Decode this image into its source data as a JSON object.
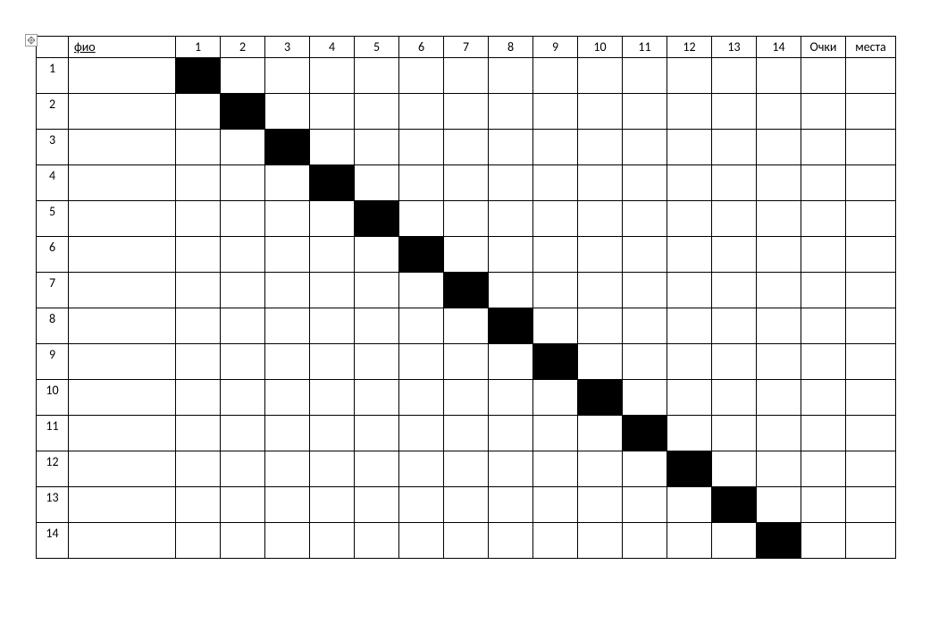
{
  "table": {
    "headers": {
      "rownum": "",
      "name": "фио",
      "cols": [
        "1",
        "2",
        "3",
        "4",
        "5",
        "6",
        "7",
        "8",
        "9",
        "10",
        "11",
        "12",
        "13",
        "14"
      ],
      "points": "Очки",
      "place": "места"
    },
    "rows": [
      {
        "num": "1",
        "name": "",
        "scores": [
          "",
          "",
          "",
          "",
          "",
          "",
          "",
          "",
          "",
          "",
          "",
          "",
          "",
          ""
        ],
        "black": 0,
        "points": "",
        "place": ""
      },
      {
        "num": "2",
        "name": "",
        "scores": [
          "",
          "",
          "",
          "",
          "",
          "",
          "",
          "",
          "",
          "",
          "",
          "",
          "",
          ""
        ],
        "black": 1,
        "points": "",
        "place": ""
      },
      {
        "num": "3",
        "name": "",
        "scores": [
          "",
          "",
          "",
          "",
          "",
          "",
          "",
          "",
          "",
          "",
          "",
          "",
          "",
          ""
        ],
        "black": 2,
        "points": "",
        "place": ""
      },
      {
        "num": "4",
        "name": "",
        "scores": [
          "",
          "",
          "",
          "",
          "",
          "",
          "",
          "",
          "",
          "",
          "",
          "",
          "",
          ""
        ],
        "black": 3,
        "points": "",
        "place": ""
      },
      {
        "num": "5",
        "name": "",
        "scores": [
          "",
          "",
          "",
          "",
          "",
          "",
          "",
          "",
          "",
          "",
          "",
          "",
          "",
          ""
        ],
        "black": 4,
        "points": "",
        "place": ""
      },
      {
        "num": "6",
        "name": "",
        "scores": [
          "",
          "",
          "",
          "",
          "",
          "",
          "",
          "",
          "",
          "",
          "",
          "",
          "",
          ""
        ],
        "black": 5,
        "points": "",
        "place": ""
      },
      {
        "num": "7",
        "name": "",
        "scores": [
          "",
          "",
          "",
          "",
          "",
          "",
          "",
          "",
          "",
          "",
          "",
          "",
          "",
          ""
        ],
        "black": 6,
        "points": "",
        "place": ""
      },
      {
        "num": "8",
        "name": "",
        "scores": [
          "",
          "",
          "",
          "",
          "",
          "",
          "",
          "",
          "",
          "",
          "",
          "",
          "",
          ""
        ],
        "black": 7,
        "points": "",
        "place": ""
      },
      {
        "num": "9",
        "name": "",
        "scores": [
          "",
          "",
          "",
          "",
          "",
          "",
          "",
          "",
          "",
          "",
          "",
          "",
          "",
          ""
        ],
        "black": 8,
        "points": "",
        "place": ""
      },
      {
        "num": "10",
        "name": "",
        "scores": [
          "",
          "",
          "",
          "",
          "",
          "",
          "",
          "",
          "",
          "",
          "",
          "",
          "",
          ""
        ],
        "black": 9,
        "points": "",
        "place": ""
      },
      {
        "num": "11",
        "name": "",
        "scores": [
          "",
          "",
          "",
          "",
          "",
          "",
          "",
          "",
          "",
          "",
          "",
          "",
          "",
          ""
        ],
        "black": 10,
        "points": "",
        "place": ""
      },
      {
        "num": "12",
        "name": "",
        "scores": [
          "",
          "",
          "",
          "",
          "",
          "",
          "",
          "",
          "",
          "",
          "",
          "",
          "",
          ""
        ],
        "black": 11,
        "points": "",
        "place": ""
      },
      {
        "num": "13",
        "name": "",
        "scores": [
          "",
          "",
          "",
          "",
          "",
          "",
          "",
          "",
          "",
          "",
          "",
          "",
          "",
          ""
        ],
        "black": 12,
        "points": "",
        "place": ""
      },
      {
        "num": "14",
        "name": "",
        "scores": [
          "",
          "",
          "",
          "",
          "",
          "",
          "",
          "",
          "",
          "",
          "",
          "",
          "",
          ""
        ],
        "black": 13,
        "points": "",
        "place": ""
      }
    ]
  }
}
